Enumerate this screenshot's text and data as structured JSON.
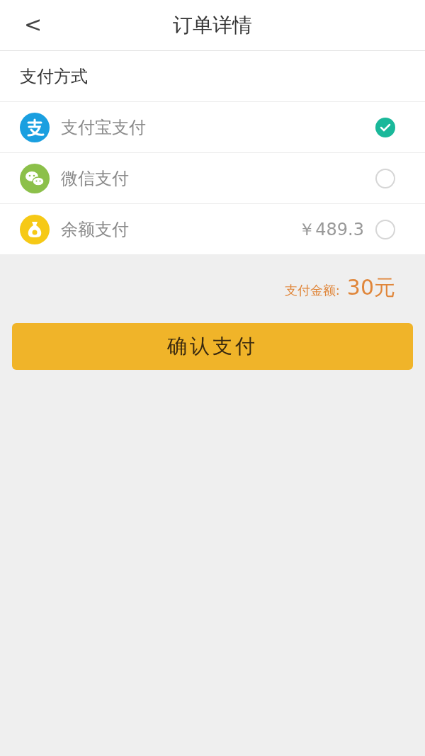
{
  "header": {
    "back": "<",
    "title": "订单详情"
  },
  "section_title": "支付方式",
  "methods": [
    {
      "kind": "alipay",
      "label": "支付宝支付",
      "selected": true
    },
    {
      "kind": "wechat",
      "label": "微信支付",
      "selected": false
    },
    {
      "kind": "wallet",
      "label": "余额支付",
      "balance": "￥489.3",
      "selected": false
    }
  ],
  "amount": {
    "label": "支付金额:",
    "value": "30元"
  },
  "confirm_button": "确认支付"
}
